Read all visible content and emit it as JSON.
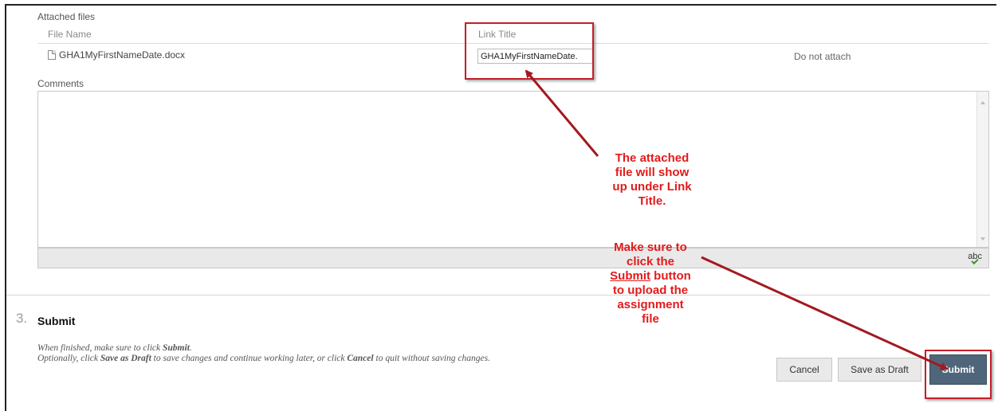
{
  "attached_files": {
    "section_label": "Attached files",
    "header_file_name": "File Name",
    "header_link_title": "Link Title",
    "file_name": "GHA1MyFirstNameDate.docx",
    "link_title_value": "GHA1MyFirstNameDate.",
    "do_not_attach": "Do not attach"
  },
  "comments": {
    "label": "Comments",
    "value": "",
    "spellcheck_label": "abc"
  },
  "annotations": {
    "link_title_note": [
      "The attached",
      "file will show",
      "up under Link",
      "Title."
    ],
    "submit_note_lines": [
      "Make sure to",
      "click the"
    ],
    "submit_note_emphasis": "Submit",
    "submit_note_after": " button",
    "submit_note_rest": [
      "to upload the",
      "assignment",
      "file"
    ],
    "color": "#e21b1b"
  },
  "step": {
    "number": "3.",
    "title": "Submit",
    "line1_prefix": "When finished, make sure to click ",
    "line1_bold": "Submit",
    "line1_suffix": ".",
    "line2_prefix": "Optionally, click ",
    "line2_bold1": "Save as Draft",
    "line2_middle": " to save changes and continue working later, or click ",
    "line2_bold2": "Cancel",
    "line2_suffix": " to quit without saving changes."
  },
  "buttons": {
    "cancel": "Cancel",
    "save_draft": "Save as Draft",
    "submit": "Submit"
  }
}
